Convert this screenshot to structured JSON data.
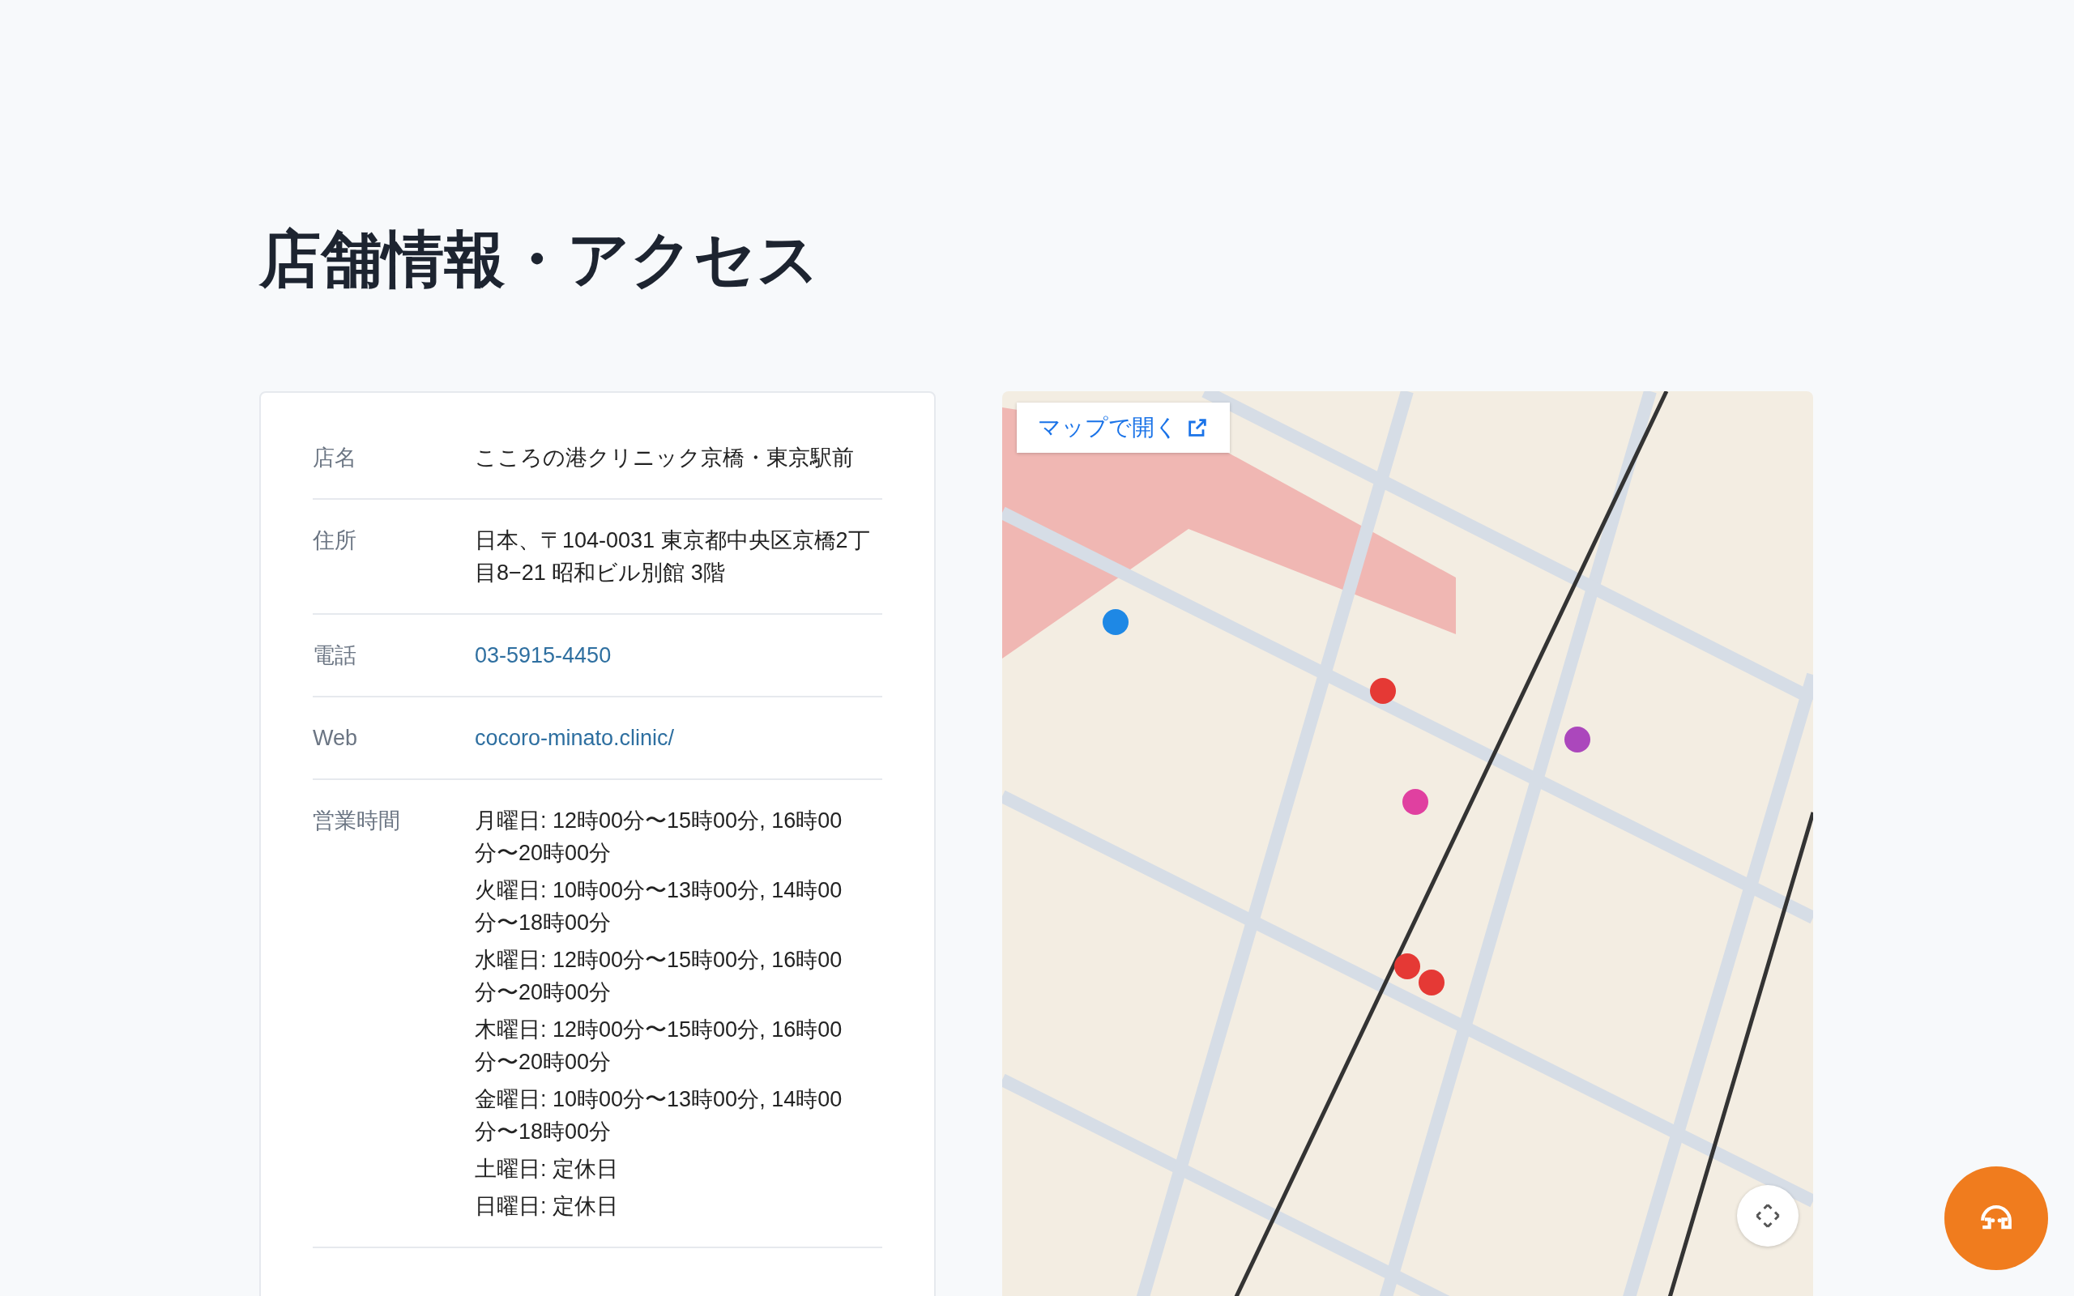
{
  "heading": "店舗情報・アクセス",
  "info": [
    {
      "label": "店名",
      "kind": "text",
      "lines": [
        "こころの港クリニック京橋・東京駅前"
      ]
    },
    {
      "label": "住所",
      "kind": "text",
      "lines": [
        "日本、〒104-0031 東京都中央区京橋2丁目8−21 昭和ビル別館 3階"
      ]
    },
    {
      "label": "電話",
      "kind": "link",
      "lines": [
        "03-5915-4450"
      ]
    },
    {
      "label": "Web",
      "kind": "link",
      "lines": [
        "cocoro-minato.clinic/"
      ]
    },
    {
      "label": "営業時間",
      "kind": "list",
      "lines": [
        "月曜日: 12時00分〜15時00分, 16時00分〜20時00分",
        "火曜日: 10時00分〜13時00分, 14時00分〜18時00分",
        "水曜日: 12時00分〜15時00分, 16時00分〜20時00分",
        "木曜日: 12時00分〜15時00分, 16時00分〜20時00分",
        "金曜日: 10時00分〜13時00分, 14時00分〜18時00分",
        "土曜日: 定休日",
        "日曜日: 定休日"
      ]
    }
  ],
  "map": {
    "open_button": "マップで開く"
  }
}
